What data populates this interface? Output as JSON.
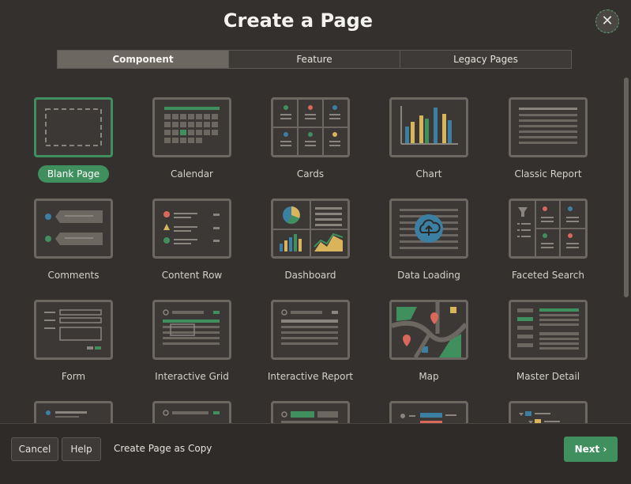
{
  "dialog": {
    "title": "Create a Page",
    "close_icon": "close-icon",
    "tabs": [
      "Component",
      "Feature",
      "Legacy Pages"
    ],
    "active_tab": "Component"
  },
  "tiles": [
    {
      "label": "Blank Page",
      "selected": true
    },
    {
      "label": "Calendar"
    },
    {
      "label": "Cards"
    },
    {
      "label": "Chart"
    },
    {
      "label": "Classic Report"
    },
    {
      "label": "Comments"
    },
    {
      "label": "Content Row"
    },
    {
      "label": "Dashboard"
    },
    {
      "label": "Data Loading"
    },
    {
      "label": "Faceted Search"
    },
    {
      "label": "Form"
    },
    {
      "label": "Interactive Grid"
    },
    {
      "label": "Interactive Report"
    },
    {
      "label": "Map"
    },
    {
      "label": "Master Detail"
    }
  ],
  "footer": {
    "cancel_label": "Cancel",
    "help_label": "Help",
    "copy_label": "Create Page as Copy",
    "next_label": "Next",
    "next_icon": "chevron-right-icon"
  },
  "colors": {
    "accent": "#3f8f5f",
    "blue": "#3b7fa3",
    "red": "#d9685a",
    "yellow": "#d9b45a"
  }
}
